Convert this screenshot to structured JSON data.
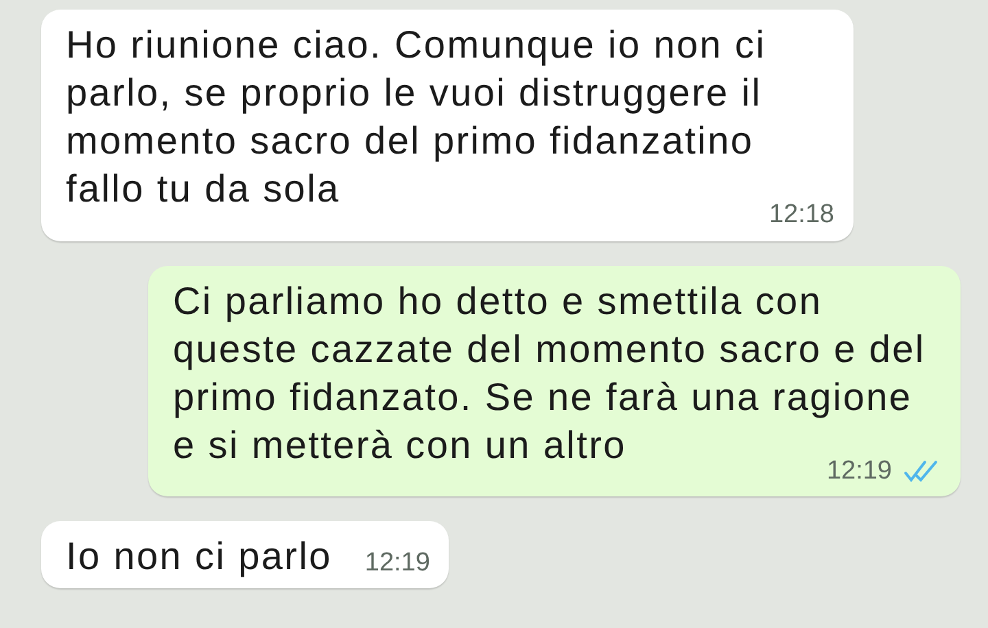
{
  "messages": [
    {
      "kind": "incoming",
      "text": "Ho riunione ciao. Comunque io non ci parlo, se proprio le vuoi distruggere il momento sacro del primo fidanzatino fallo tu da sola",
      "time": "12:18"
    },
    {
      "kind": "outgoing",
      "text": "Ci parliamo ho detto e smettila con queste cazzate del momento sacro e del primo fidanzato. Se ne farà una ragione e si metterà con un altro",
      "time": "12:19",
      "read": true
    },
    {
      "kind": "incoming",
      "text": "Io non ci parlo",
      "time": "12:19"
    }
  ]
}
